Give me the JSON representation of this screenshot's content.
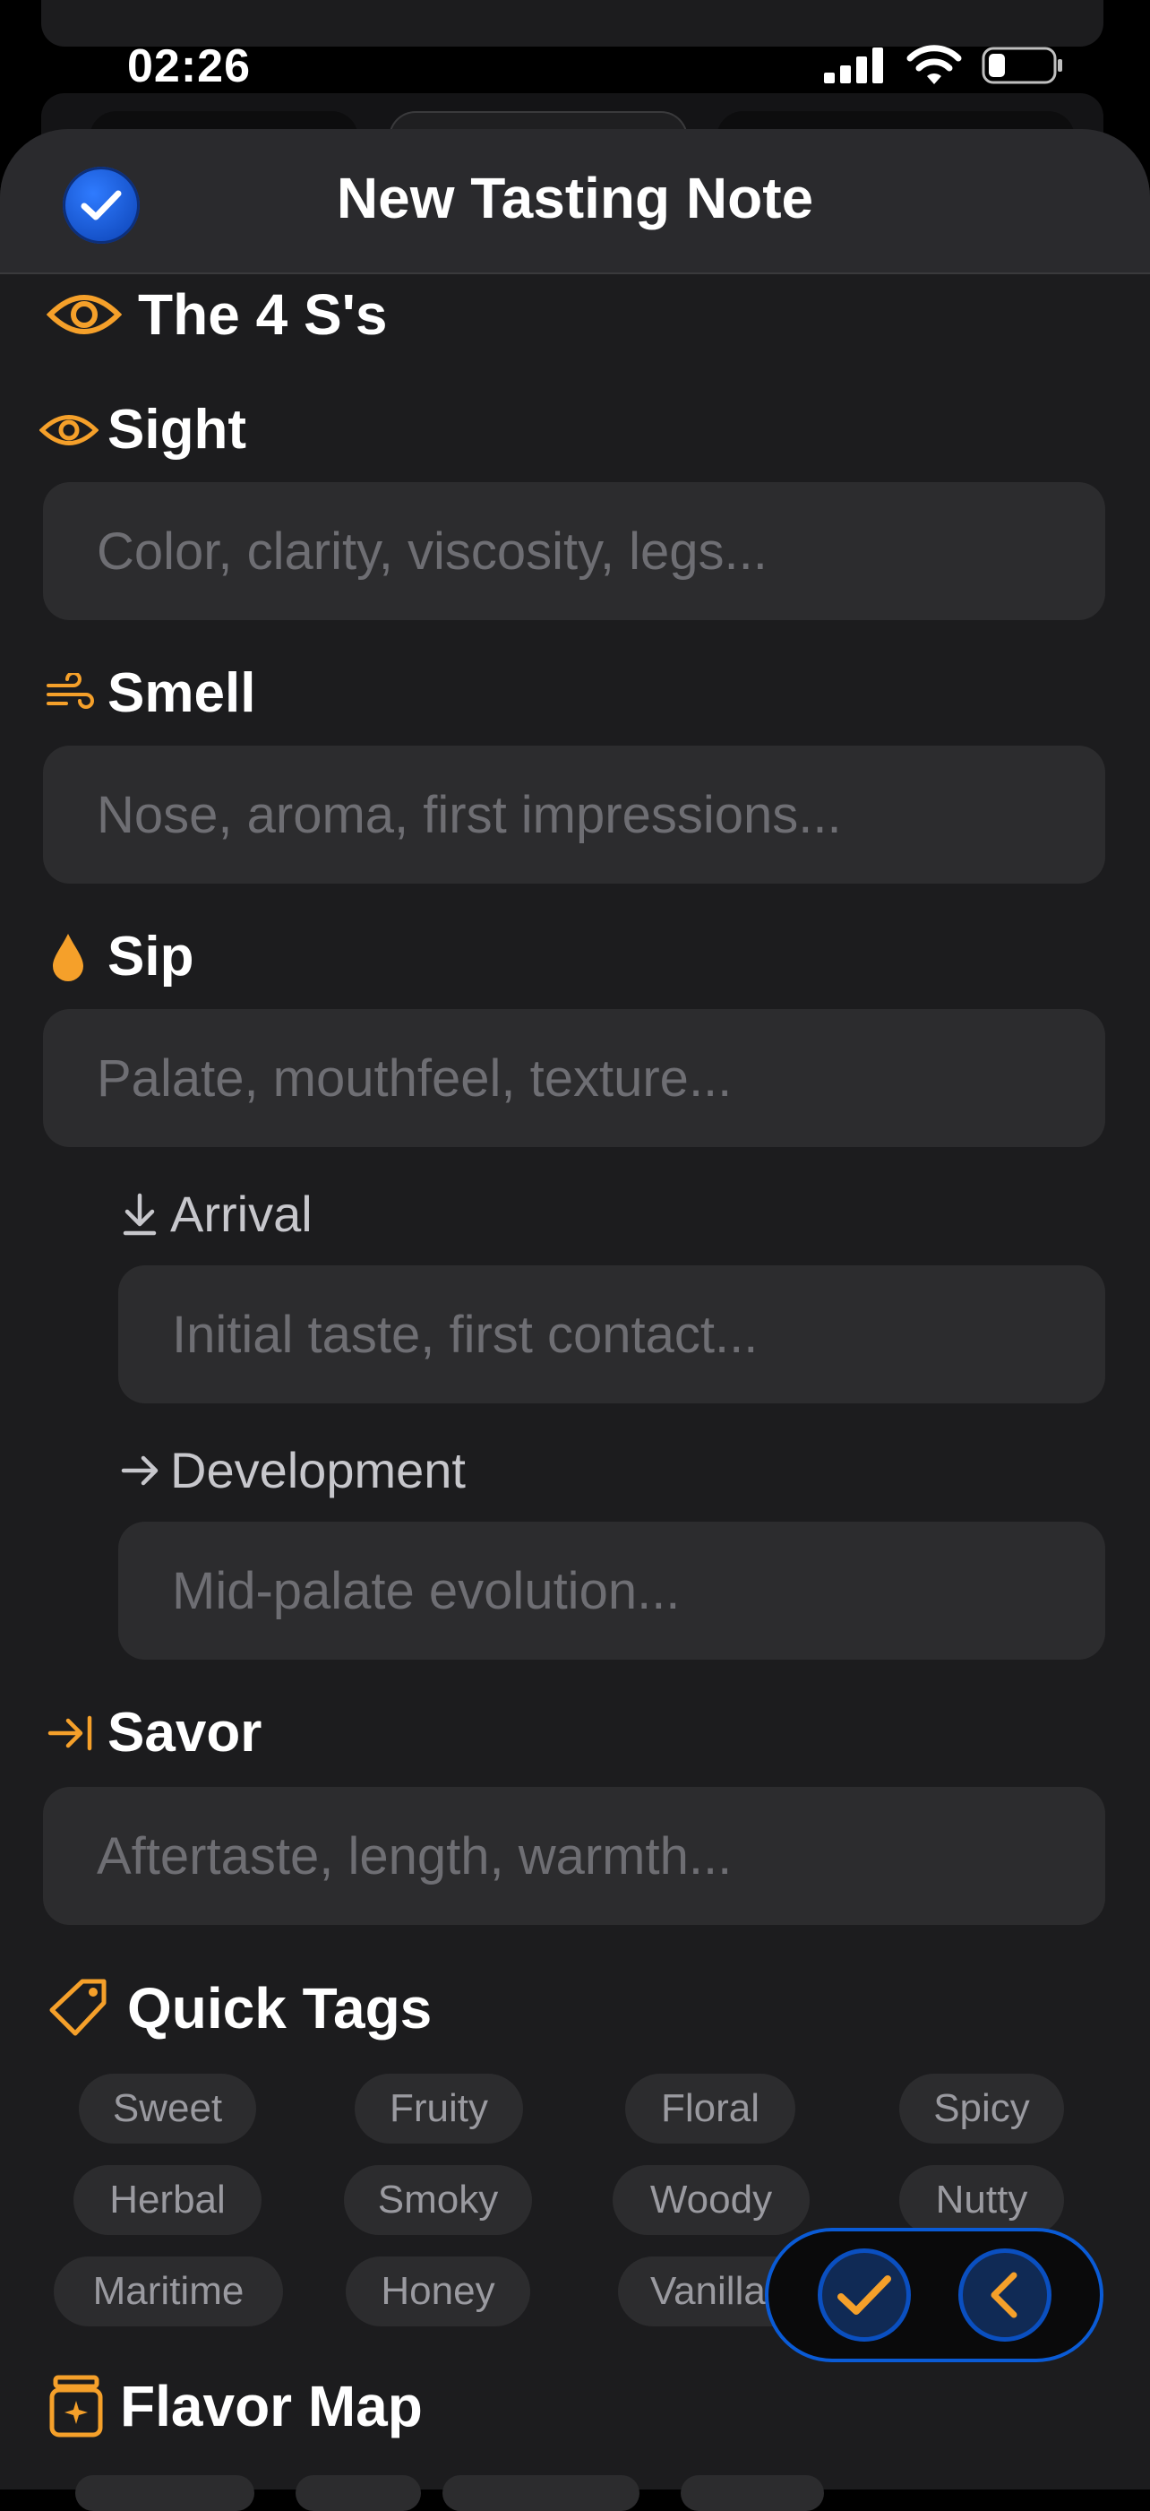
{
  "status_bar": {
    "time": "02:26"
  },
  "sheet": {
    "title": "New Tasting Note"
  },
  "four_s": {
    "title": "The 4 S's",
    "sight": {
      "label": "Sight",
      "placeholder": "Color, clarity, viscosity, legs..."
    },
    "smell": {
      "label": "Smell",
      "placeholder": "Nose, aroma, first impressions..."
    },
    "sip": {
      "label": "Sip",
      "placeholder": "Palate, mouthfeel, texture...",
      "arrival": {
        "label": "Arrival",
        "placeholder": "Initial taste, first contact..."
      },
      "development": {
        "label": "Development",
        "placeholder": "Mid-palate evolution..."
      }
    },
    "savor": {
      "label": "Savor",
      "placeholder": "Aftertaste, length, warmth..."
    }
  },
  "quick_tags": {
    "title": "Quick Tags",
    "tags": [
      "Sweet",
      "Fruity",
      "Floral",
      "Spicy",
      "Herbal",
      "Smoky",
      "Woody",
      "Nutty",
      "Maritime",
      "Honey",
      "Vanilla"
    ]
  },
  "flavor_map": {
    "title": "Flavor Map"
  },
  "colors": {
    "accent": "#F5A02A",
    "blue": "#0A5BD6",
    "background": "#1C1C1E",
    "field": "#2C2C2E"
  },
  "icons": [
    "eye-icon",
    "wind-icon",
    "drop-icon",
    "arrow-down-to-line-icon",
    "arrow-right-icon",
    "arrow-right-to-line-icon",
    "tag-icon",
    "jar-sparkle-icon",
    "checkmark-icon",
    "chevron-left-icon"
  ]
}
